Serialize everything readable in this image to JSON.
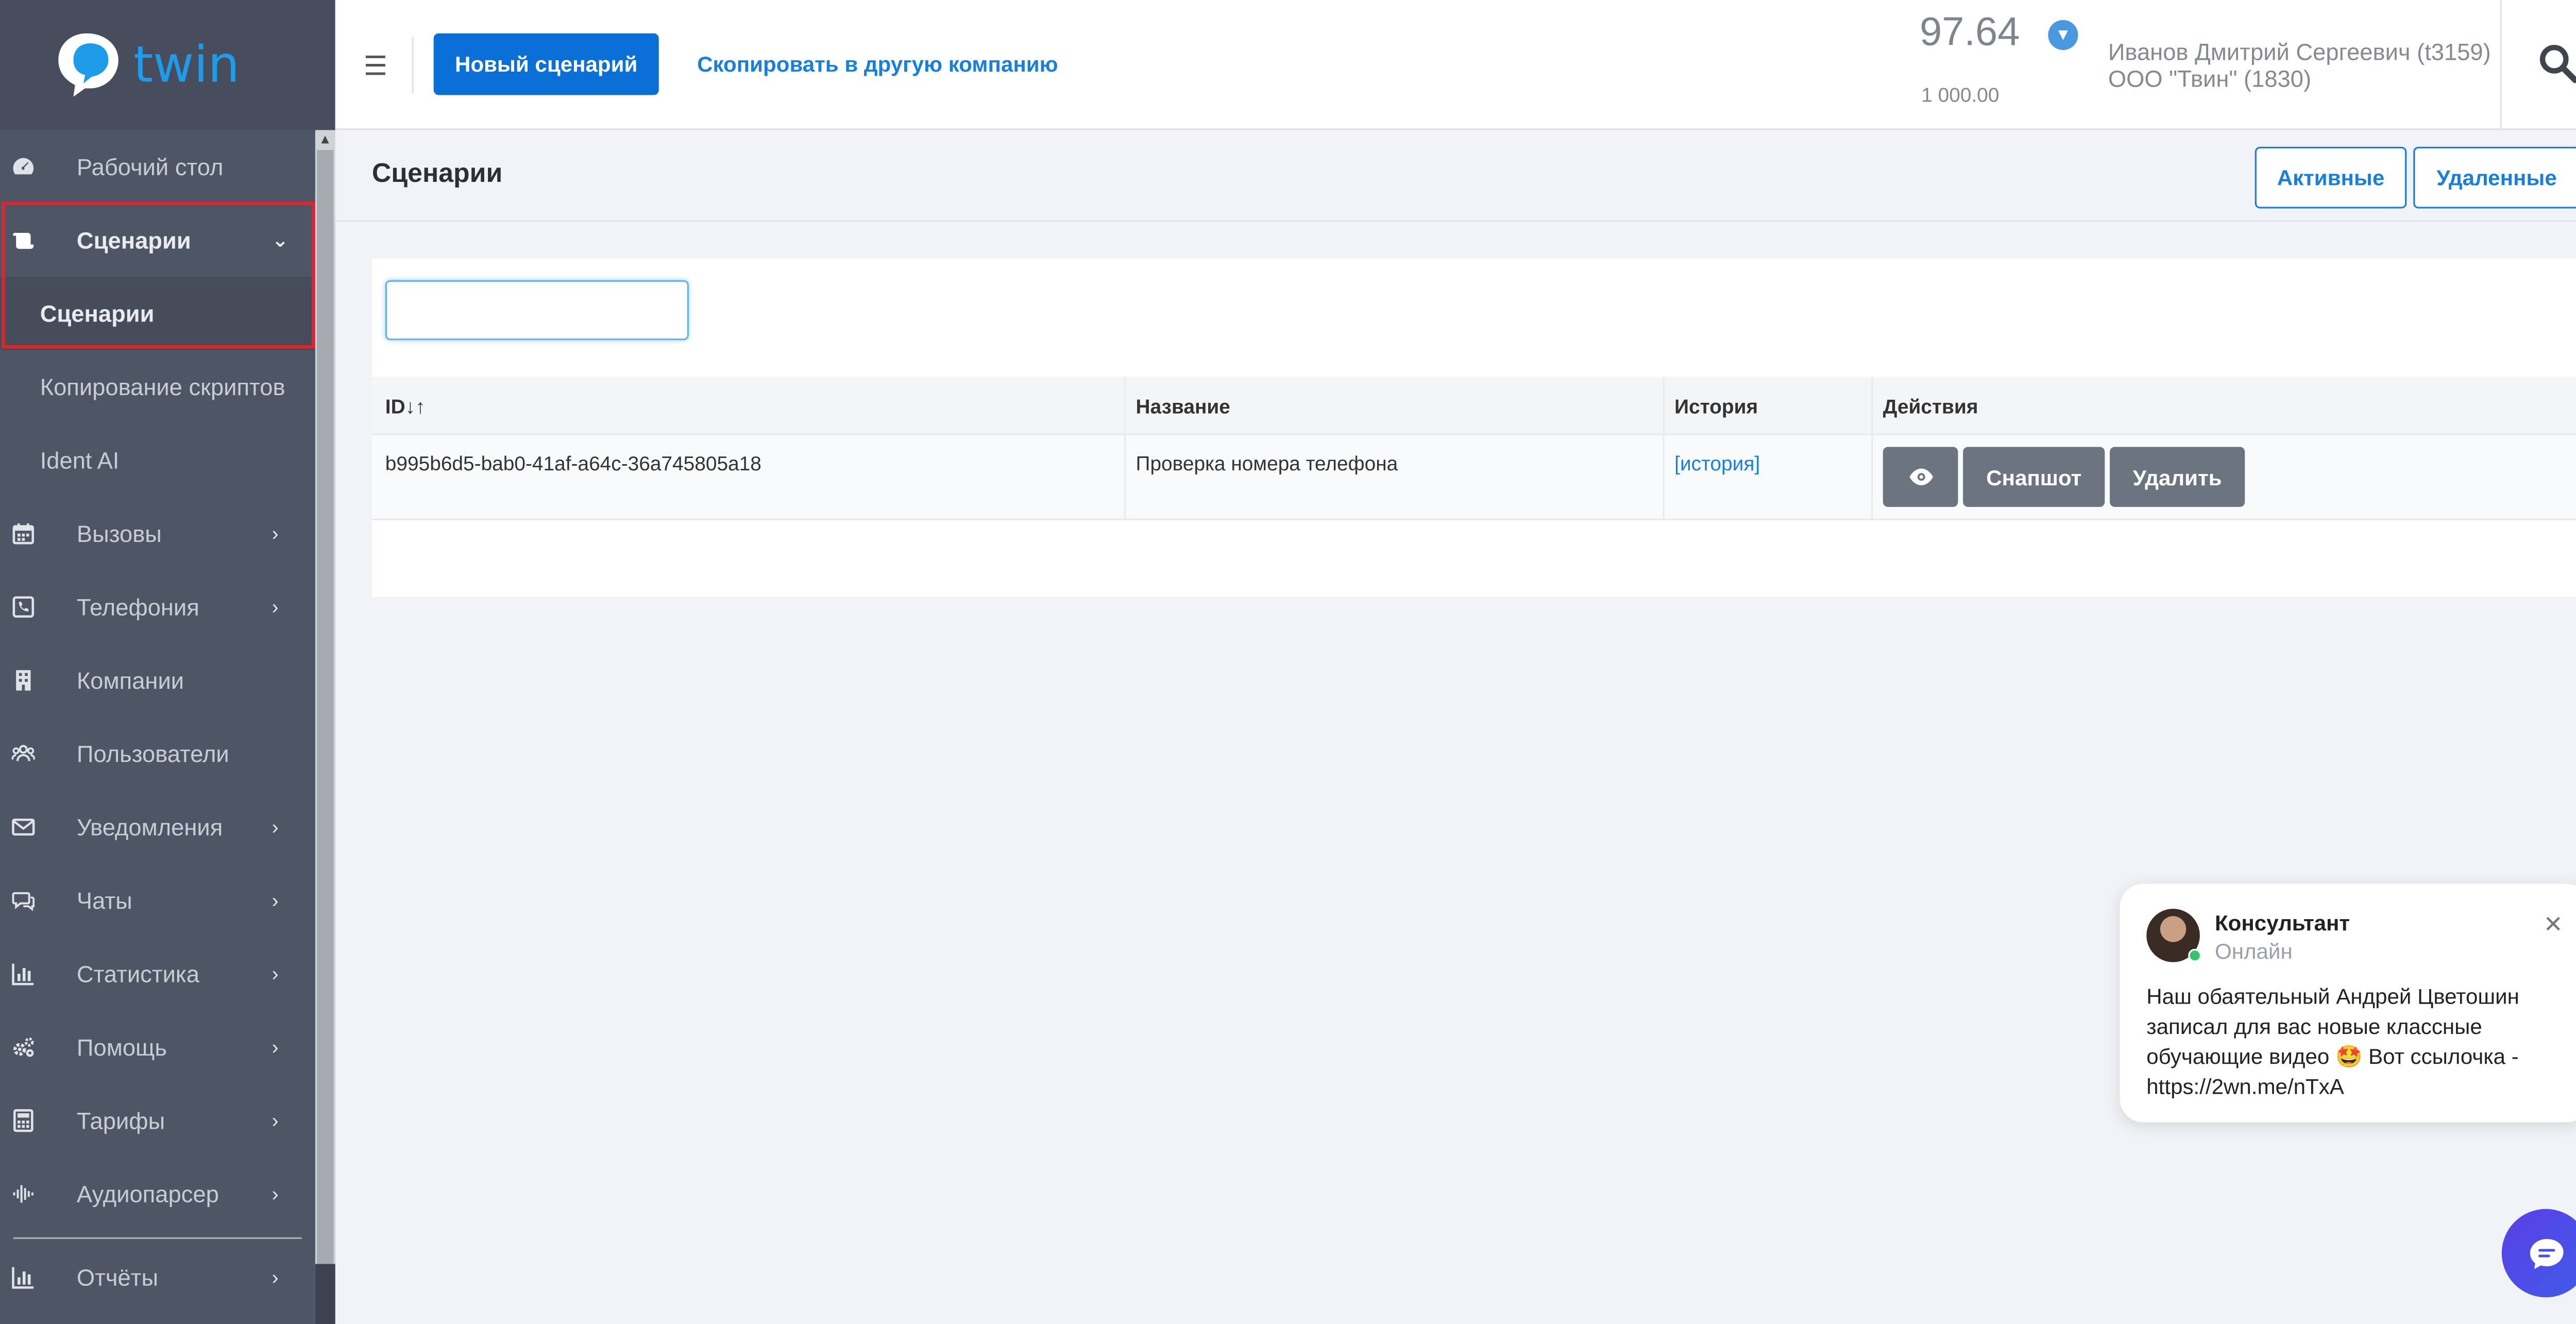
{
  "brand": {
    "logo_text": "twin",
    "accent_color": "#0a6fd6",
    "logo_color": "#1e9be9",
    "highlight_color": "#e0242c"
  },
  "sidebar": {
    "items": [
      {
        "label": "Рабочий стол",
        "icon": "dashboard-icon"
      },
      {
        "label": "Сценарии",
        "icon": "scenarios-icon",
        "expanded": true
      },
      {
        "label": "Сценарии",
        "sub": true,
        "active": true
      },
      {
        "label": "Копирование скриптов",
        "sub": true
      },
      {
        "label": "Ident AI",
        "sub": true
      },
      {
        "label": "Вызовы",
        "icon": "calendar-icon"
      },
      {
        "label": "Телефония",
        "icon": "phone-icon"
      },
      {
        "label": "Компании",
        "icon": "building-icon"
      },
      {
        "label": "Пользователи",
        "icon": "users-icon"
      },
      {
        "label": "Уведомления",
        "icon": "envelope-icon"
      },
      {
        "label": "Чаты",
        "icon": "chat-icon"
      },
      {
        "label": "Статистика",
        "icon": "bar-chart-icon"
      },
      {
        "label": "Помощь",
        "icon": "gears-icon"
      },
      {
        "label": "Тарифы",
        "icon": "calculator-icon"
      },
      {
        "label": "Аудиопарсер",
        "icon": "audio-wave-icon"
      },
      {
        "label": "Отчёты",
        "icon": "report-chart-icon"
      }
    ]
  },
  "header": {
    "new_scenario_label": "Новый сценарий",
    "copy_link_label": "Скопировать в другую компанию",
    "balance": "97.64",
    "credit": "1 000.00",
    "user_name": "Иванов Дмитрий Сергеевич (t3159)",
    "user_company": "ООО \"Твин\" (1830)"
  },
  "page": {
    "title": "Сценарии",
    "tabs": [
      "Активные",
      "Удаленные"
    ]
  },
  "table": {
    "filter_value": "",
    "columns": [
      "ID",
      "Название",
      "История",
      "Действия"
    ],
    "sort_glyph": "↓↑",
    "rows": [
      {
        "id": "b995b6d5-bab0-41af-a64c-36a745805a18",
        "name": "Проверка номера телефона",
        "history": "[история]",
        "actions": [
          "Снапшот",
          "Удалить"
        ]
      }
    ]
  },
  "chat": {
    "agent_name": "Консультант",
    "status": "Онлайн",
    "message": "Наш обаятельный Андрей Цветошин записал для вас новые классные обучающие видео 🤩 Вот ссылочка - https://2wn.me/nTxA"
  }
}
